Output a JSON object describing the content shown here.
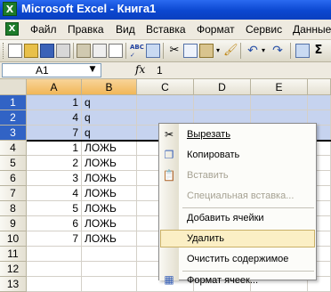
{
  "window": {
    "title": "Microsoft Excel - Книга1"
  },
  "menu": {
    "items": [
      "Файл",
      "Правка",
      "Вид",
      "Вставка",
      "Формат",
      "Сервис",
      "Данные"
    ]
  },
  "formula_bar": {
    "name_box": "A1",
    "fx": "fx",
    "value": "1"
  },
  "columns": [
    "A",
    "B",
    "C",
    "D",
    "E"
  ],
  "rows": [
    {
      "num": "1",
      "a": "1",
      "b": "q"
    },
    {
      "num": "2",
      "a": "4",
      "b": "q"
    },
    {
      "num": "3",
      "a": "7",
      "b": "q"
    },
    {
      "num": "4",
      "a": "1",
      "b": "ЛОЖЬ"
    },
    {
      "num": "5",
      "a": "2",
      "b": "ЛОЖЬ"
    },
    {
      "num": "6",
      "a": "3",
      "b": "ЛОЖЬ"
    },
    {
      "num": "7",
      "a": "4",
      "b": "ЛОЖЬ"
    },
    {
      "num": "8",
      "a": "5",
      "b": "ЛОЖЬ"
    },
    {
      "num": "9",
      "a": "6",
      "b": "ЛОЖЬ"
    },
    {
      "num": "10",
      "a": "7",
      "b": "ЛОЖЬ"
    },
    {
      "num": "11",
      "a": "",
      "b": ""
    },
    {
      "num": "12",
      "a": "",
      "b": ""
    },
    {
      "num": "13",
      "a": "",
      "b": ""
    }
  ],
  "context_menu": {
    "cut": "Вырезать",
    "copy": "Копировать",
    "paste": "Вставить",
    "paste_special": "Специальная вставка...",
    "insert_cells": "Добавить ячейки",
    "delete": "Удалить",
    "clear_contents": "Очистить содержимое",
    "format_cells": "Формат ячеек..."
  },
  "colors": {
    "title_bar": "#0b47d0",
    "selection": "#c6d3ef",
    "selected_header": "#3163c5",
    "menu_highlight": "#fbefc5"
  }
}
